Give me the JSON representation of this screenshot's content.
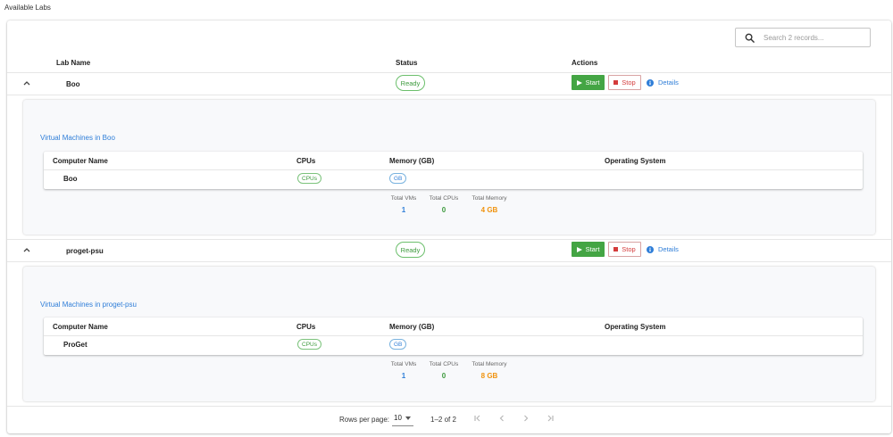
{
  "page": {
    "title": "Available Labs"
  },
  "search": {
    "placeholder": "Search 2 records..."
  },
  "table": {
    "headers": {
      "lab_name": "Lab Name",
      "status": "Status",
      "actions": "Actions"
    }
  },
  "labs": [
    {
      "name": "Boo",
      "status": "Ready",
      "actions": {
        "start": "Start",
        "stop": "Stop",
        "details": "Details"
      },
      "panel": {
        "title": "Virtual Machines in Boo",
        "vm_headers": {
          "computer_name": "Computer Name",
          "cpus": "CPUs",
          "memory": "Memory (GB)",
          "os": "Operating System"
        },
        "vms": [
          {
            "name": "Boo",
            "cpus": "CPUs",
            "memory": "GB",
            "os": ""
          }
        ],
        "summary": {
          "total_vms_label": "Total VMs",
          "total_vms": "1",
          "total_cpus_label": "Total CPUs",
          "total_cpus": "0",
          "total_memory_label": "Total Memory",
          "total_memory": "4 GB"
        }
      }
    },
    {
      "name": "proget-psu",
      "status": "Ready",
      "actions": {
        "start": "Start",
        "stop": "Stop",
        "details": "Details"
      },
      "panel": {
        "title": "Virtual Machines in proget-psu",
        "vm_headers": {
          "computer_name": "Computer Name",
          "cpus": "CPUs",
          "memory": "Memory (GB)",
          "os": "Operating System"
        },
        "vms": [
          {
            "name": "ProGet",
            "cpus": "CPUs",
            "memory": "GB",
            "os": ""
          }
        ],
        "summary": {
          "total_vms_label": "Total VMs",
          "total_vms": "1",
          "total_cpus_label": "Total CPUs",
          "total_cpus": "0",
          "total_memory_label": "Total Memory",
          "total_memory": "8 GB"
        }
      }
    }
  ],
  "pagination": {
    "rows_per_page_label": "Rows per page:",
    "rows_per_page": "10",
    "range": "1–2 of 2"
  },
  "icons": {
    "search": "search-icon",
    "expand": "chevron-up-icon",
    "start": "play-icon",
    "stop": "stop-icon",
    "details": "info-icon",
    "first": "first-page-icon",
    "prev": "prev-page-icon",
    "next": "next-page-icon",
    "last": "last-page-icon"
  },
  "colors": {
    "start": "#44a544",
    "stop": "#d43c3c",
    "link": "#2f7ed8",
    "ready": "#3d9a3d",
    "memory": "#f0930e"
  }
}
